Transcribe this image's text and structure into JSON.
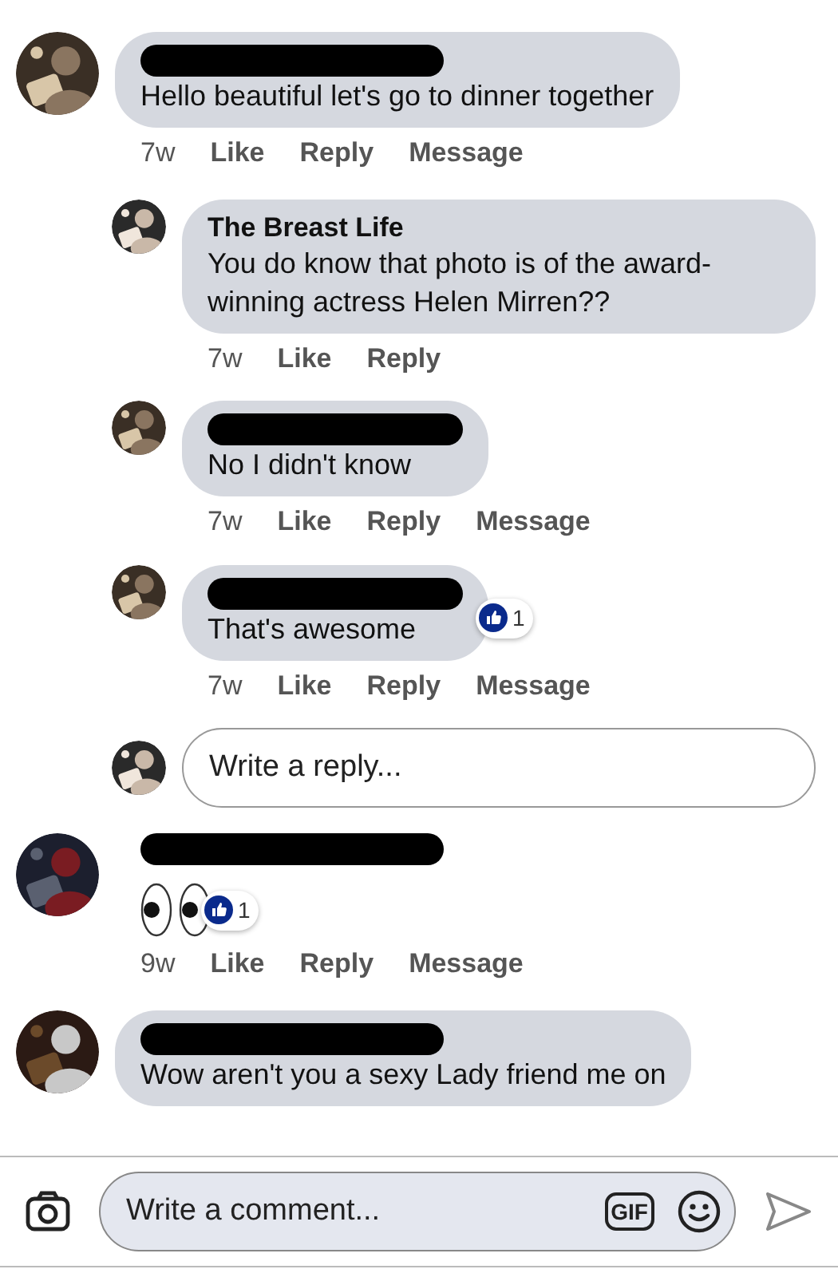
{
  "comments": [
    {
      "kind": "text",
      "author_redacted": true,
      "text": "Hello beautiful let's go to dinner together",
      "time": "7w",
      "actions": [
        "Like",
        "Reply",
        "Message"
      ],
      "replies": [
        {
          "kind": "text",
          "author": "The Breast Life",
          "text": "You do know that photo is of the award-winning actress Helen Mirren??",
          "time": "7w",
          "actions": [
            "Like",
            "Reply"
          ]
        },
        {
          "kind": "text",
          "author_redacted": true,
          "text": "No I didn't know",
          "time": "7w",
          "actions": [
            "Like",
            "Reply",
            "Message"
          ]
        },
        {
          "kind": "text",
          "author_redacted": true,
          "text": "That's awesome",
          "reaction_count": "1",
          "time": "7w",
          "actions": [
            "Like",
            "Reply",
            "Message"
          ]
        }
      ],
      "reply_box": {
        "placeholder": "Write a reply..."
      }
    },
    {
      "kind": "emoji",
      "author_redacted": true,
      "reaction_count": "1",
      "time": "9w",
      "actions": [
        "Like",
        "Reply",
        "Message"
      ]
    },
    {
      "kind": "text",
      "author_redacted": true,
      "text": "Wow aren't you a sexy Lady friend me on"
    }
  ],
  "composer": {
    "placeholder": "Write a comment...",
    "gif_label": "GIF"
  }
}
